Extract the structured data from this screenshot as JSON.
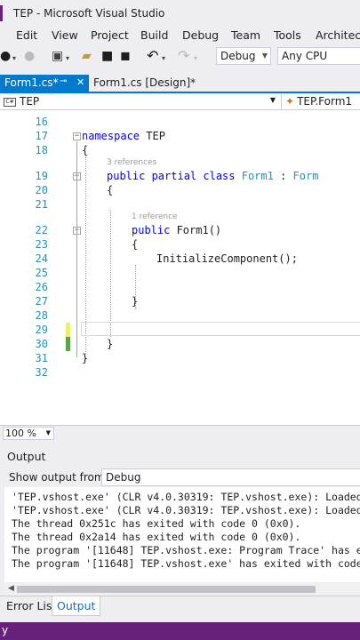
{
  "window": {
    "title": "TEP - Microsoft Visual Studio"
  },
  "menu": {
    "edit": "Edit",
    "view": "View",
    "project": "Project",
    "build": "Build",
    "debug": "Debug",
    "team": "Team",
    "tools": "Tools",
    "architecture": "Architectu"
  },
  "toolbar": {
    "config": "Debug",
    "platform": "Any CPU"
  },
  "tabs": {
    "tab1": {
      "label": "Form1.cs*",
      "pin": "⊸",
      "close": "✕"
    },
    "tab2": {
      "label": "Form1.cs [Design]*"
    }
  },
  "nav": {
    "project": "TEP",
    "member": "TEP.Form1"
  },
  "editor": {
    "lines": {
      "l16": "16",
      "l17": "17",
      "l18": "18",
      "l19": "19",
      "l20": "20",
      "l21": "21",
      "l22": "22",
      "l23": "23",
      "l24": "24",
      "l25": "25",
      "l26": "26",
      "l27": "27",
      "l28": "28",
      "l29": "29",
      "l30": "30",
      "l31": "31",
      "l32": "32"
    },
    "code": {
      "ns_kw": "namespace",
      "ns_name": " TEP",
      "brace_open": "{",
      "brace_close": "}",
      "cls_kw": "public partial class",
      "cls_name": "Form1",
      "cls_colon": " : ",
      "cls_base": "Form",
      "ctor_kw": "public",
      "ctor_name": " Form1()",
      "init_call": "InitializeComponent();"
    },
    "lens": {
      "refs3": "3 references",
      "ref1": "1 reference"
    }
  },
  "zoom": {
    "value": "100 %"
  },
  "output": {
    "title": "Output",
    "show_from_label": "Show output from:",
    "source": "Debug",
    "lines": [
      "'TEP.vshost.exe' (CLR v4.0.30319: TEP.vshost.exe): Loaded",
      "'TEP.vshost.exe' (CLR v4.0.30319: TEP.vshost.exe): Loaded",
      "The thread 0x251c has exited with code 0 (0x0).",
      "The thread 0x2a14 has exited with code 0 (0x0).",
      "The program '[11648] TEP.vshost.exe: Program Trace' has e",
      "The program '[11648] TEP.vshost.exe' has exited with code"
    ]
  },
  "bottom_tabs": {
    "error_list": "Error List",
    "output": "Output"
  },
  "status": {
    "text": "y"
  },
  "colors": {
    "accent": "#007acc",
    "status_bar": "#68217a",
    "keyword": "#0000ff",
    "type": "#2b91af"
  }
}
